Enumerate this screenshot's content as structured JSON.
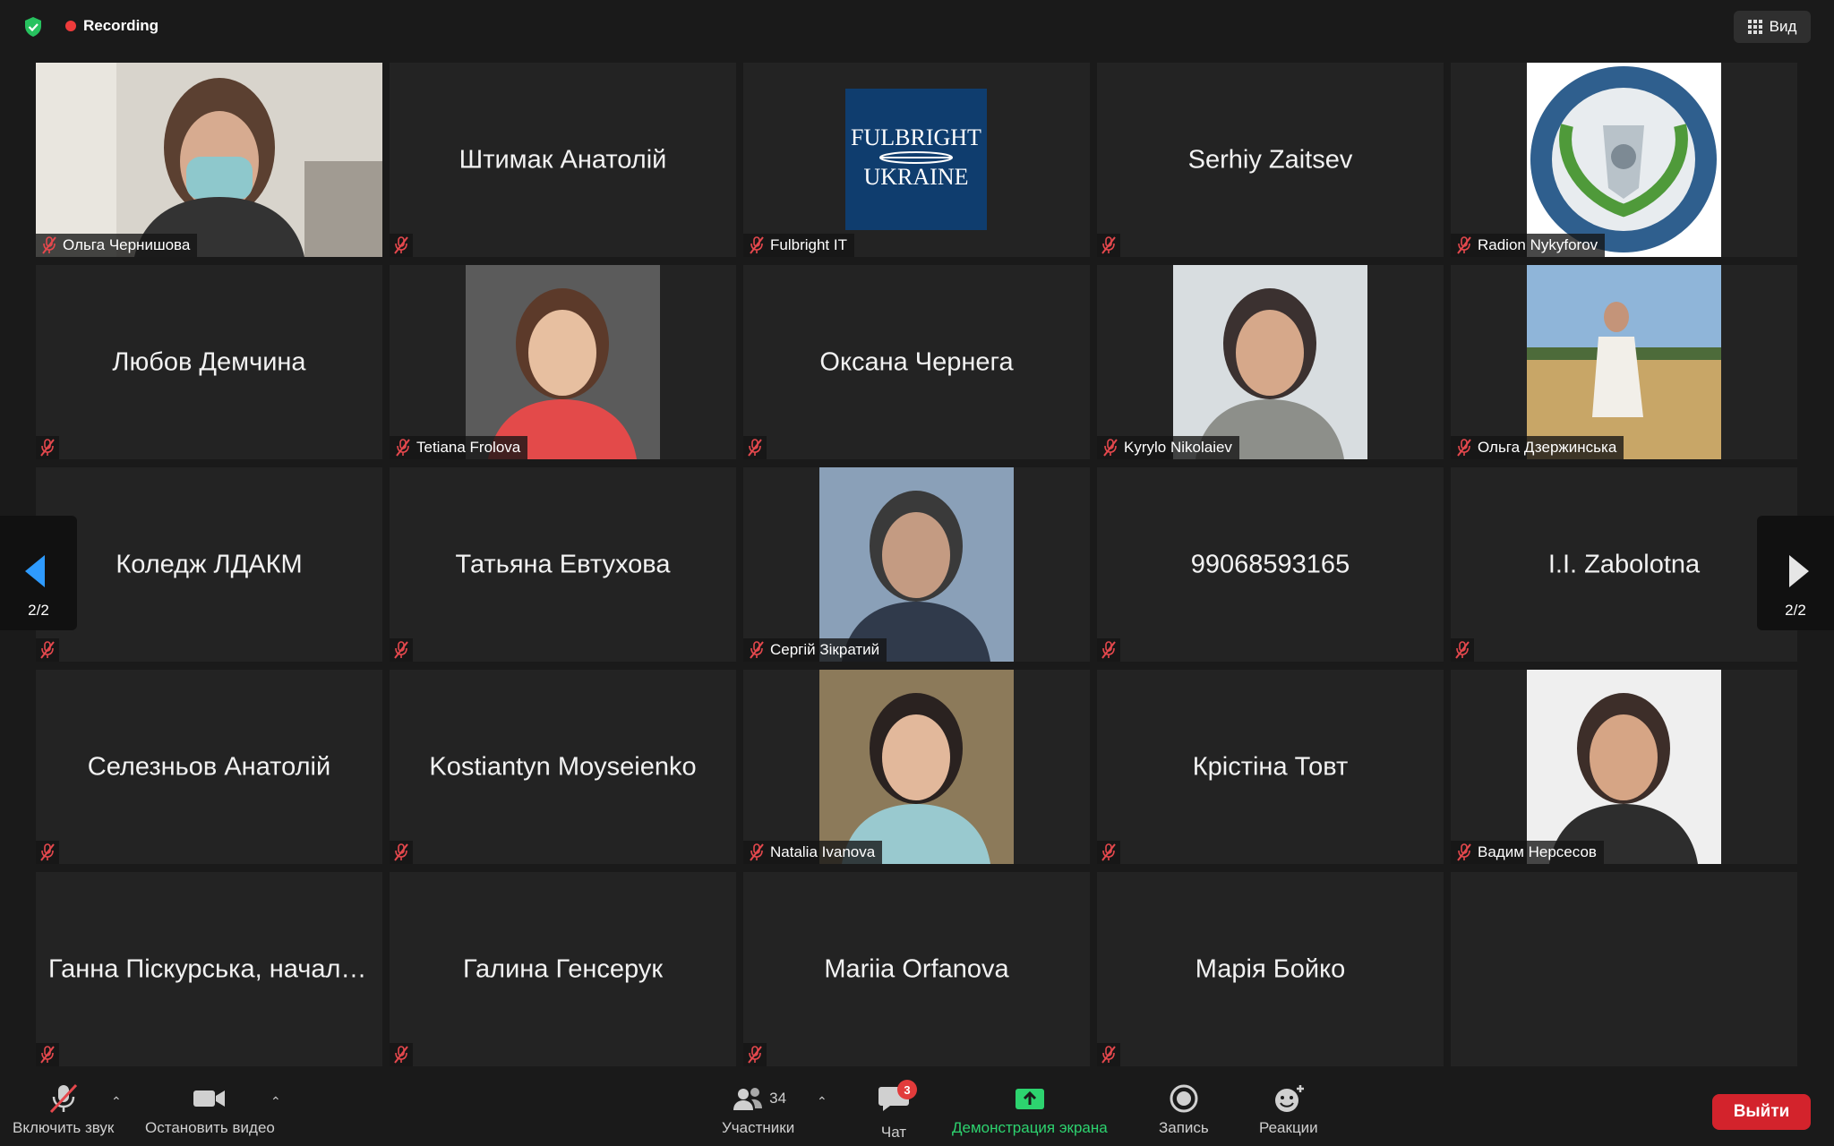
{
  "topbar": {
    "recording_label": "Recording",
    "view_label": "Вид"
  },
  "pager": {
    "left": "2/2",
    "right": "2/2"
  },
  "tiles": [
    {
      "name": "Ольга Чернишова",
      "kind": "photo",
      "image": "person-masked-photo"
    },
    {
      "name": "Штимак Анатолій",
      "kind": "text"
    },
    {
      "name": "Fulbright IT",
      "kind": "photo",
      "image": "fulbright-ukraine-logo",
      "logo_text": [
        "FULBRIGHT",
        "UKRAINE"
      ]
    },
    {
      "name": "Serhiy Zaitsev",
      "kind": "text"
    },
    {
      "name": "Radion Nykyforov",
      "kind": "photo",
      "image": "university-emblem"
    },
    {
      "name": "Любов Демчина",
      "kind": "text"
    },
    {
      "name": "Tetiana Frolova",
      "kind": "photo",
      "image": "person-photo"
    },
    {
      "name": "Оксана Чернега",
      "kind": "text"
    },
    {
      "name": "Kyrylo Nikolaiev",
      "kind": "photo",
      "image": "person-photo"
    },
    {
      "name": "Ольга Дзержинська",
      "kind": "photo",
      "image": "person-in-field-photo"
    },
    {
      "name": "Коледж ЛДАКМ",
      "kind": "text"
    },
    {
      "name": "Татьяна Евтухова",
      "kind": "text"
    },
    {
      "name": "Сергій Зікратий",
      "kind": "photo",
      "image": "person-photo"
    },
    {
      "name": "99068593165",
      "kind": "text"
    },
    {
      "name": "I.I. Zabolotna",
      "kind": "text"
    },
    {
      "name": "Селезньов Анатолій",
      "kind": "text"
    },
    {
      "name": "Kostiantyn Moyseienko",
      "kind": "text"
    },
    {
      "name": "Natalia Ivanova",
      "kind": "photo",
      "image": "person-photo"
    },
    {
      "name": "Крістіна Товт",
      "kind": "text"
    },
    {
      "name": "Вадим Нерсесов",
      "kind": "photo",
      "image": "person-photo"
    },
    {
      "name": "Ганна Піскурська, началь...",
      "kind": "text"
    },
    {
      "name": "Галина Генсерук",
      "kind": "text"
    },
    {
      "name": "Mariia Orfanova",
      "kind": "text"
    },
    {
      "name": "Марія Бойко",
      "kind": "text"
    },
    {
      "name": "",
      "kind": "empty"
    }
  ],
  "toolbar": {
    "unmute_label": "Включить звук",
    "stop_video_label": "Остановить видео",
    "participants_label": "Участники",
    "participants_count": "34",
    "chat_label": "Чат",
    "chat_badge": "3",
    "share_label": "Демонстрация экрана",
    "record_label": "Запись",
    "reactions_label": "Реакции",
    "leave_label": "Выйти"
  },
  "colors": {
    "background": "#1a1a1a",
    "tile": "#232323",
    "recording": "#ee3b3b",
    "share": "#2dd36f",
    "leave": "#d3232c",
    "mute_icon": "#e5484d"
  }
}
